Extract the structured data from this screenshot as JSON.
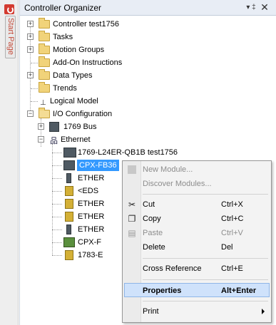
{
  "side_tab": {
    "label": "Start Page"
  },
  "panel": {
    "title": "Controller Organizer",
    "pin_glyph": "▾ ‡",
    "close_glyph": "✕"
  },
  "tree": {
    "controller": "Controller test1756",
    "tasks": "Tasks",
    "motion_groups": "Motion Groups",
    "aoi": "Add-On Instructions",
    "data_types": "Data Types",
    "trends": "Trends",
    "logical_model": "Logical Model",
    "io_config": "I/O Configuration",
    "bus_1769": "1769 Bus",
    "ethernet": "Ethernet",
    "children": [
      "1769-L24ER-QB1B test1756",
      "CPX-FB36",
      "ETHER",
      "<EDS",
      "ETHER",
      "ETHER",
      "ETHER",
      "CPX-F",
      "1783-E"
    ]
  },
  "context_menu": {
    "new_module": "New Module...",
    "discover_modules": "Discover Modules...",
    "cut": "Cut",
    "cut_shortcut": "Ctrl+X",
    "copy": "Copy",
    "copy_shortcut": "Ctrl+C",
    "paste": "Paste",
    "paste_shortcut": "Ctrl+V",
    "delete": "Delete",
    "delete_shortcut": "Del",
    "cross_reference": "Cross Reference",
    "cross_reference_shortcut": "Ctrl+E",
    "properties": "Properties",
    "properties_shortcut": "Alt+Enter",
    "print": "Print"
  },
  "colors": {
    "selection": "#3399ff",
    "menu_highlight": "#cfe2fb",
    "start_icon": "#d33a2f"
  }
}
